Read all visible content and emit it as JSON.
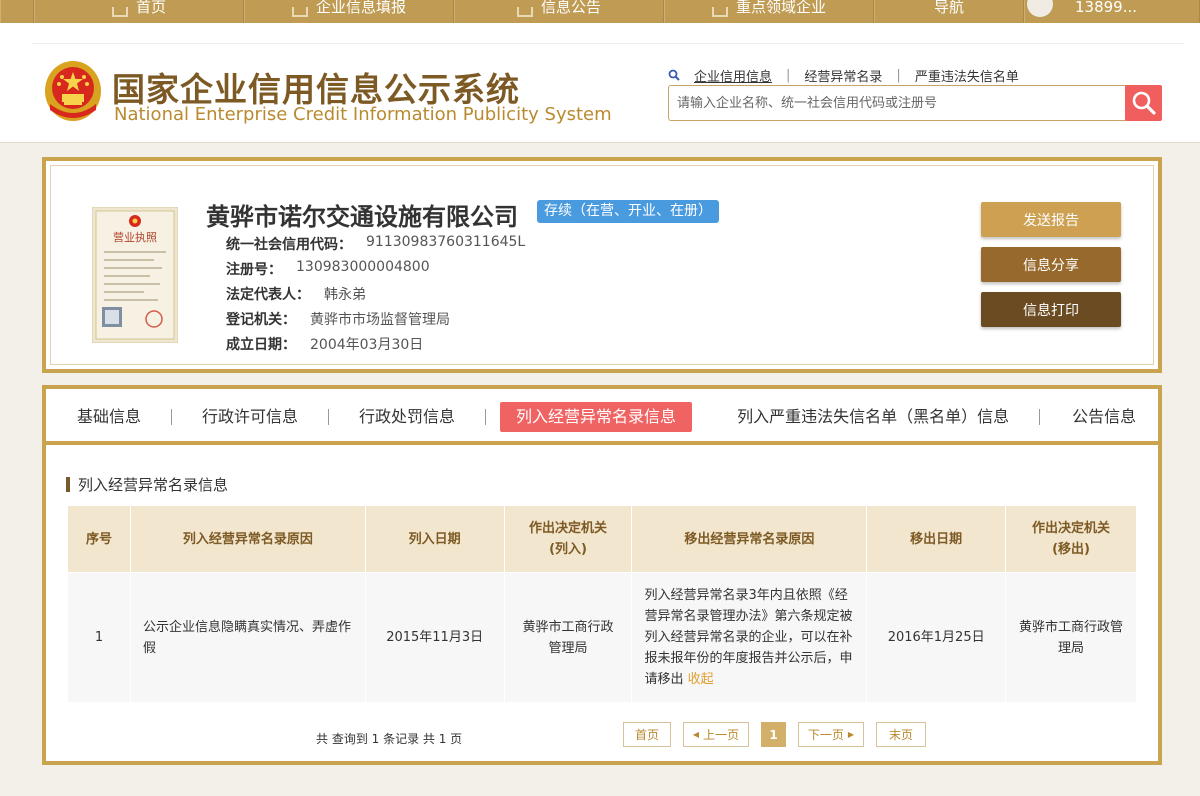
{
  "topnav": {
    "items": [
      {
        "label": "首页"
      },
      {
        "label": "企业信息填报"
      },
      {
        "label": "信息公告"
      },
      {
        "label": "重点领域企业"
      },
      {
        "label": "导航"
      }
    ],
    "user": "13899..."
  },
  "header": {
    "title": "国家企业信用信息公示系统",
    "subtitle": "National Enterprise Credit Information Publicity System",
    "links": [
      "企业信用信息",
      "经营异常名录",
      "严重违法失信名单"
    ],
    "search_placeholder": "请输入企业名称、统一社会信用代码或注册号"
  },
  "company": {
    "name": "黄骅市诺尔交通设施有限公司",
    "status": "存续（在营、开业、在册）",
    "license_text": "营业执照",
    "fields": [
      {
        "label": "统一社会信用代码：",
        "value": "91130983760311645L"
      },
      {
        "label": "注册号：",
        "value": "130983000004800"
      },
      {
        "label": "法定代表人：",
        "value": "韩永弟"
      },
      {
        "label": "登记机关：",
        "value": "黄骅市市场监督管理局"
      },
      {
        "label": "成立日期：",
        "value": "2004年03月30日"
      }
    ],
    "buttons": {
      "report": "发送报告",
      "share": "信息分享",
      "print": "信息打印"
    }
  },
  "tabs": [
    "基础信息",
    "行政许可信息",
    "行政处罚信息",
    "列入经营异常名录信息",
    "列入严重违法失信名单（黑名单）信息",
    "公告信息"
  ],
  "section": {
    "title": "列入经营异常名录信息",
    "columns": [
      "序号",
      "列入经营异常名录原因",
      "列入日期",
      "作出决定机关（列入）",
      "移出经营异常名录原因",
      "移出日期",
      "作出决定机关（移出）"
    ],
    "col_lines": {
      "c4a": "作出决定机关",
      "c4b": "(列入)",
      "c7a": "作出决定机关",
      "c7b": "(移出)"
    },
    "rows": [
      {
        "no": "1",
        "reason": "公示企业信息隐瞒真实情况、弄虚作假",
        "date": "2015年11月3日",
        "authority": "黄骅市工商行政管理局",
        "remove_reason": "列入经营异常名录3年内且依照《经营异常名录管理办法》第六条规定被列入经营异常名录的企业，可以在补报未报年份的年度报告并公示后，申请移出",
        "remove_reason_fold": "收起",
        "remove_date": "2016年1月25日",
        "remove_authority": "黄骅市工商行政管理局"
      }
    ]
  },
  "pager": {
    "summary": "共 查询到 1 条记录 共 1 页",
    "first": "首页",
    "prev": "上一页",
    "current": "1",
    "next": "下一页",
    "last": "末页"
  },
  "colors": {
    "gold": "#c9a34e",
    "nav": "#bf9b53",
    "badge": "#4a9ae0",
    "active_tab": "#f06363",
    "search_btn": "#f05e5e",
    "btn_report": "#cda052",
    "btn_share": "#98692c",
    "btn_print": "#6b4c22"
  }
}
